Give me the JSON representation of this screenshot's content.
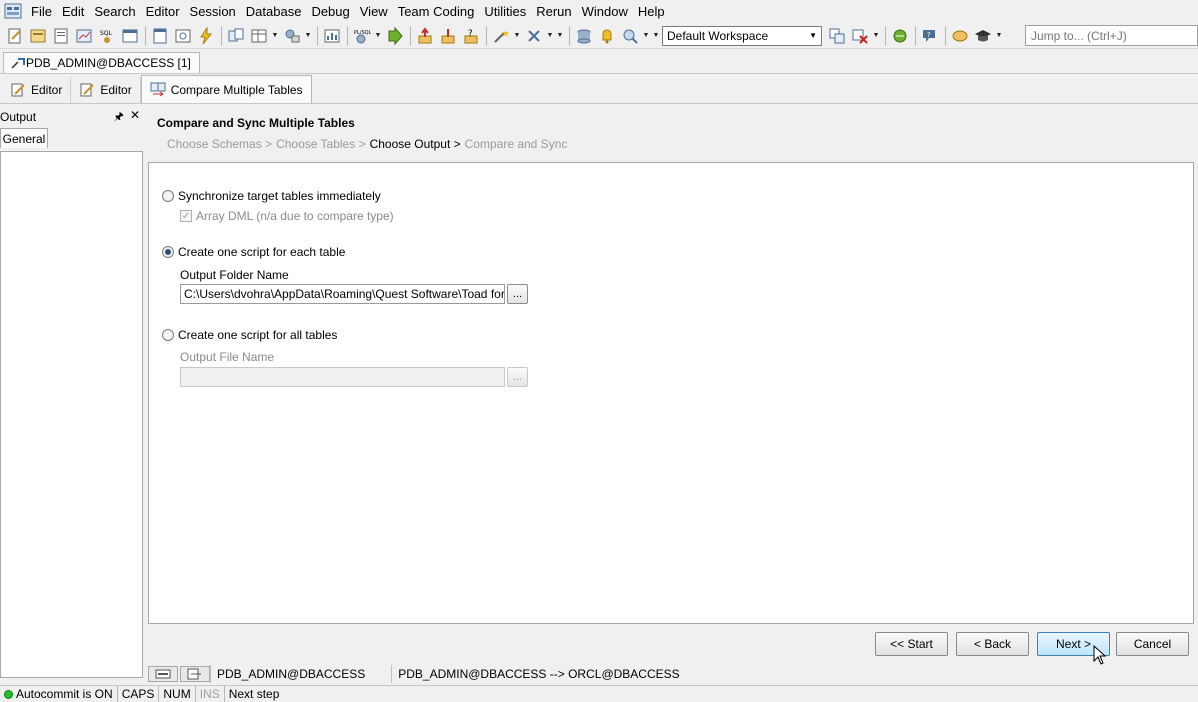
{
  "menu": {
    "items": [
      {
        "label": "File"
      },
      {
        "label": "Edit"
      },
      {
        "label": "Search"
      },
      {
        "label": "Editor"
      },
      {
        "label": "Session"
      },
      {
        "label": "Database"
      },
      {
        "label": "Debug"
      },
      {
        "label": "View"
      },
      {
        "label": "Team Coding"
      },
      {
        "label": "Utilities"
      },
      {
        "label": "Rerun"
      },
      {
        "label": "Window"
      },
      {
        "label": "Help"
      }
    ]
  },
  "toolbar": {
    "workspace": "Default Workspace",
    "jump_placeholder": "Jump to... (Ctrl+J)"
  },
  "connection_tab": {
    "label": "PDB_ADMIN@DBACCESS [1]"
  },
  "doc_tabs": [
    {
      "label": "Editor"
    },
    {
      "label": "Editor"
    },
    {
      "label": "Compare Multiple Tables"
    }
  ],
  "output_panel": {
    "title": "Output",
    "tab": "General"
  },
  "wizard": {
    "title": "Compare and Sync Multiple Tables",
    "steps": [
      "Choose Schemas >",
      "Choose Tables >",
      "Choose Output >",
      "Compare and Sync"
    ],
    "current_step": "Choose Output",
    "options": {
      "sync_label": "Synchronize target tables immediately",
      "array_dml_label": "Array DML (n/a due to compare type)",
      "one_script_each_label": "Create one script for each table",
      "output_folder_label": "Output Folder Name",
      "output_folder_value": "C:\\Users\\dvohra\\AppData\\Roaming\\Quest Software\\Toad for Orac",
      "one_script_all_label": "Create one script for all tables",
      "output_file_label": "Output File Name",
      "output_file_value": "",
      "browse": "..."
    },
    "buttons": {
      "start": "<< Start",
      "back": "< Back",
      "next": "Next >",
      "cancel": "Cancel"
    }
  },
  "connection_status": {
    "session": "PDB_ADMIN@DBACCESS",
    "compare": "PDB_ADMIN@DBACCESS --> ORCL@DBACCESS"
  },
  "statusbar": {
    "autocommit": "Autocommit is ON",
    "caps": "CAPS",
    "num": "NUM",
    "ins": "INS",
    "message": "Next step"
  }
}
